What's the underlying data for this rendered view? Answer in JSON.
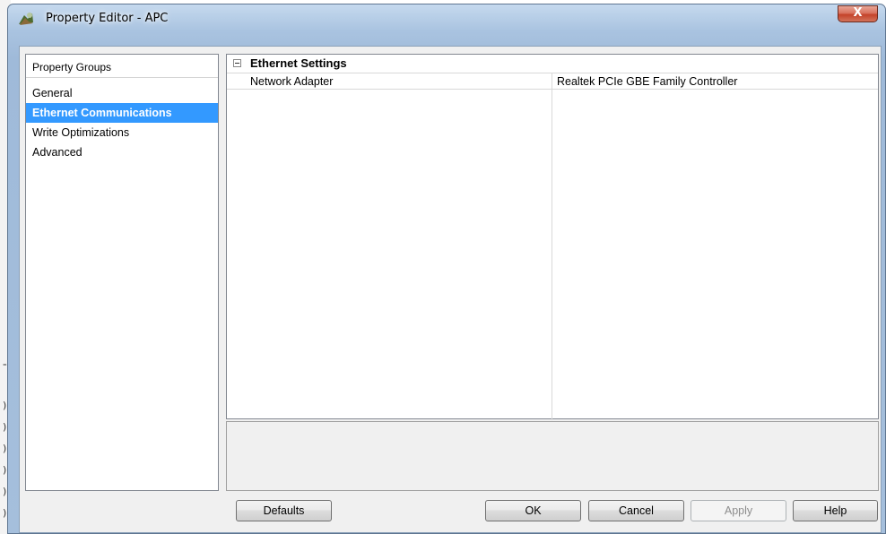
{
  "window": {
    "title": "Property Editor - APC",
    "close_glyph": "X"
  },
  "background_glyphs": [
    "⁼",
    ")",
    ")",
    ")",
    ")",
    ")",
    ")"
  ],
  "groups": {
    "header": "Property Groups",
    "items": [
      {
        "label": "General",
        "selected": false
      },
      {
        "label": "Ethernet Communications",
        "selected": true
      },
      {
        "label": "Write Optimizations",
        "selected": false
      },
      {
        "label": "Advanced",
        "selected": false
      }
    ]
  },
  "grid": {
    "section_title": "Ethernet Settings",
    "rows": [
      {
        "name": "Network Adapter",
        "value": "Realtek PCIe GBE Family Controller"
      }
    ]
  },
  "buttons": {
    "defaults": "Defaults",
    "ok": "OK",
    "cancel": "Cancel",
    "apply": "Apply",
    "help": "Help"
  },
  "colors": {
    "selection": "#3399ff",
    "close_button": "#c4432a",
    "frame": "#a9c3e0"
  }
}
